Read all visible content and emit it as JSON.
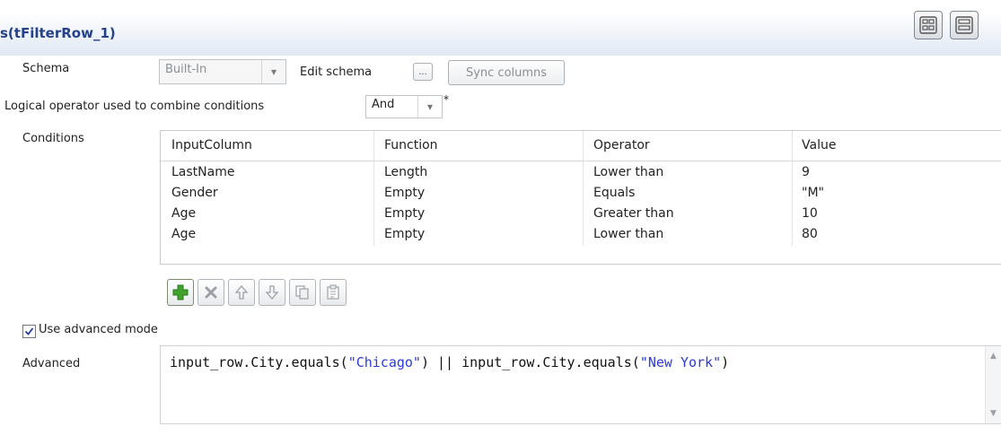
{
  "header": {
    "title": "s(tFilterRow_1)",
    "view_buttons": [
      "grid-view-icon",
      "list-view-icon"
    ]
  },
  "schema": {
    "label": "Schema",
    "value": "Built-In",
    "edit_label": "Edit schema",
    "ellipsis": "...",
    "sync_label": "Sync columns"
  },
  "logical": {
    "label": "Logical operator used to combine conditions",
    "value": "And",
    "marker": "*"
  },
  "conditions": {
    "label": "Conditions",
    "columns": [
      "InputColumn",
      "Function",
      "Operator",
      "Value"
    ],
    "rows": [
      [
        "LastName",
        "Length",
        "Lower than",
        "9"
      ],
      [
        "Gender",
        "Empty",
        "Equals",
        "\"M\""
      ],
      [
        "Age",
        "Empty",
        "Greater than",
        "10"
      ],
      [
        "Age",
        "Empty",
        "Lower than",
        "80"
      ]
    ],
    "toolbar": [
      "add-icon",
      "remove-icon",
      "move-up-icon",
      "move-down-icon",
      "copy-icon",
      "paste-icon"
    ]
  },
  "advanced_mode": {
    "label": "Use advanced mode",
    "checked": true
  },
  "advanced": {
    "label": "Advanced",
    "code_parts": [
      "input_row.City.equals(",
      "\"Chicago\"",
      ") || input_row.City.equals(",
      "\"New York\"",
      ")"
    ]
  },
  "colors": {
    "title": "#24418a",
    "string_literal": "#2a3bd6",
    "add_icon": "#3ea32b"
  }
}
